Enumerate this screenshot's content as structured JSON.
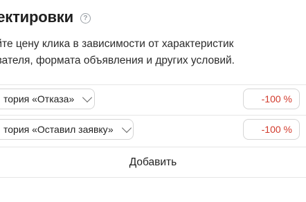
{
  "header": {
    "title": "ректировки",
    "help_icon_glyph": "?"
  },
  "description": {
    "line1": "яйте цену клика в зависимости от характеристик",
    "line2": "ователя, формата объявления и других условий."
  },
  "adjustments": [
    {
      "condition": "тория «Отказа»",
      "value": "-100 %"
    },
    {
      "condition": "тория «Оставил заявку»",
      "value": "-100 %"
    }
  ],
  "add_button": {
    "label": "Добавить"
  },
  "colors": {
    "negative_value": "#d23a2c",
    "border": "#d5d5d5",
    "divider": "#e6e6e6"
  }
}
